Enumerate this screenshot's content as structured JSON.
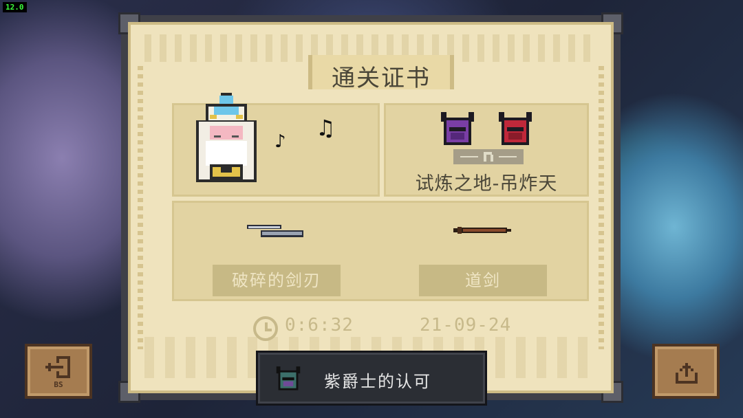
{
  "hud": {
    "fps": "12.0"
  },
  "certificate": {
    "title": "通关证书",
    "mode_name": "试炼之地-吊炸天",
    "weapons": [
      {
        "name": "破碎的剑刃",
        "icon": "broken-blade-icon"
      },
      {
        "name": "道剑",
        "icon": "taoist-sword-icon"
      }
    ],
    "time": "0:6:32",
    "date": "21-09-24"
  },
  "buttons": {
    "exit_sub_label": "BS",
    "exit_icon": "exit-door-icon",
    "share_icon": "share-upload-icon"
  },
  "achievement": {
    "label": "紫爵士的认可",
    "icon": "purple-knight-helmet-icon"
  },
  "colors": {
    "parchment": "#efe3bd",
    "panel": "#e2d3a2",
    "text_dark": "#4a4638",
    "button_brown": "#a57c50",
    "achievement_bg": "#2b2e34"
  }
}
